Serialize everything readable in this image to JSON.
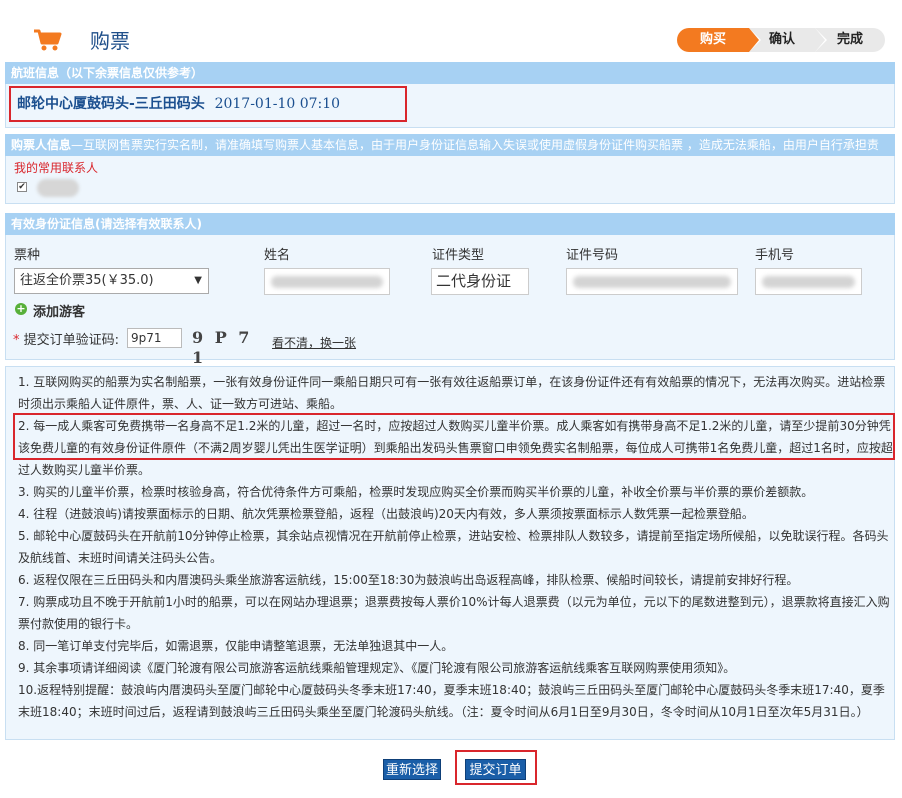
{
  "header": {
    "title": "购票",
    "steps": [
      "购买",
      "确认",
      "完成"
    ]
  },
  "voyage": {
    "bar_title": "航班信息（以下余票信息仅供参考）",
    "route": "邮轮中心厦鼓码头-三丘田码头",
    "datetime": "2017-01-10 07:10"
  },
  "buyer": {
    "bar_title": "购票人信息",
    "bar_note": "—互联网售票实行实名制，请准确填写购票人基本信息，由于用户身份证信息输入失误或使用虚假身份证件购买船票 ，造成无法乘船，由用户自行承担责",
    "contacts_label": "我的常用联系人",
    "contact_checked": "✔"
  },
  "id_info": {
    "bar_title": "有效身份证信息(请选择有效联系人)",
    "columns": [
      "票种",
      "姓名",
      "证件类型",
      "证件号码",
      "手机号"
    ],
    "ticket_type": "往返全价票35(￥35.0)",
    "id_type": "二代身份证",
    "add_passenger": "添加游客"
  },
  "captcha": {
    "label": "提交订单验证码:",
    "required_mark": "*",
    "value": "9p71",
    "image_text": "9 P 7 1",
    "refresh_link": "看不清，换一张"
  },
  "notes": [
    "1. 互联网购买的船票为实名制船票，一张有效身份证件同一乘船日期只可有一张有效往返船票订单，在该身份证件还有有效船票的情况下，无法再次购买。进站检票时须出示乘船人证件原件，票、人、证一致方可进站、乘船。",
    "2. 每一成人乘客可免费携带一名身高不足1.2米的儿童，超过一名时，应按超过人数购买儿童半价票。成人乘客如有携带身高不足1.2米的儿童，请至少提前30分钟凭该免费儿童的有效身份证件原件（不满2周岁婴儿凭出生医学证明）到乘船出发码头售票窗口申领免费实名制船票，每位成人可携带1名免费儿童，超过1名时，应按超过人数购买儿童半价票。",
    "3. 购买的儿童半价票，检票时核验身高，符合优待条件方可乘船，检票时发现应购买全价票而购买半价票的儿童，补收全价票与半价票的票价差额款。",
    "4. 往程（进鼓浪屿)请按票面标示的日期、航次凭票检票登船，返程（出鼓浪屿)20天内有效，多人票须按票面标示人数凭票一起检票登船。",
    "5. 邮轮中心厦鼓码头在开航前10分钟停止检票，其余站点视情况在开航前停止检票，进站安检、检票排队人数较多，请提前至指定场所候船，以免耽误行程。各码头及航线首、末班时间请关注码头公告。",
    "6. 返程仅限在三丘田码头和内厝澳码头乘坐旅游客运航线，15:00至18:30为鼓浪屿出岛返程高峰，排队检票、候船时间较长，请提前安排好行程。",
    "7. 购票成功且不晚于开航前1小时的船票，可以在网站办理退票；退票费按每人票价10%计每人退票费（以元为单位，元以下的尾数进整到元），退票款将直接汇入购票付款使用的银行卡。",
    "8. 同一笔订单支付完毕后，如需退票，仅能申请整笔退票，无法单独退其中一人。",
    "9. 其余事项请详细阅读《厦门轮渡有限公司旅游客运航线乘船管理规定》、《厦门轮渡有限公司旅游客运航线乘客互联网购票使用须知》。",
    "10.返程特别提醒：鼓浪屿内厝澳码头至厦门邮轮中心厦鼓码头冬季末班17:40，夏季末班18:40；鼓浪屿三丘田码头至厦门邮轮中心厦鼓码头冬季末班17:40，夏季末班18:40；末班时间过后，返程请到鼓浪屿三丘田码头乘坐至厦门轮渡码头航线。（注：夏令时间从6月1日至9月30日，冬令时间从10月1日至次年5月31日。）"
  ],
  "actions": {
    "reselect": "重新选择",
    "submit": "提交订单"
  },
  "colors": {
    "accent": "#f37a20",
    "bar": "#a7d1f3",
    "highlight": "#d9262c",
    "button": "#1a5ea8"
  }
}
